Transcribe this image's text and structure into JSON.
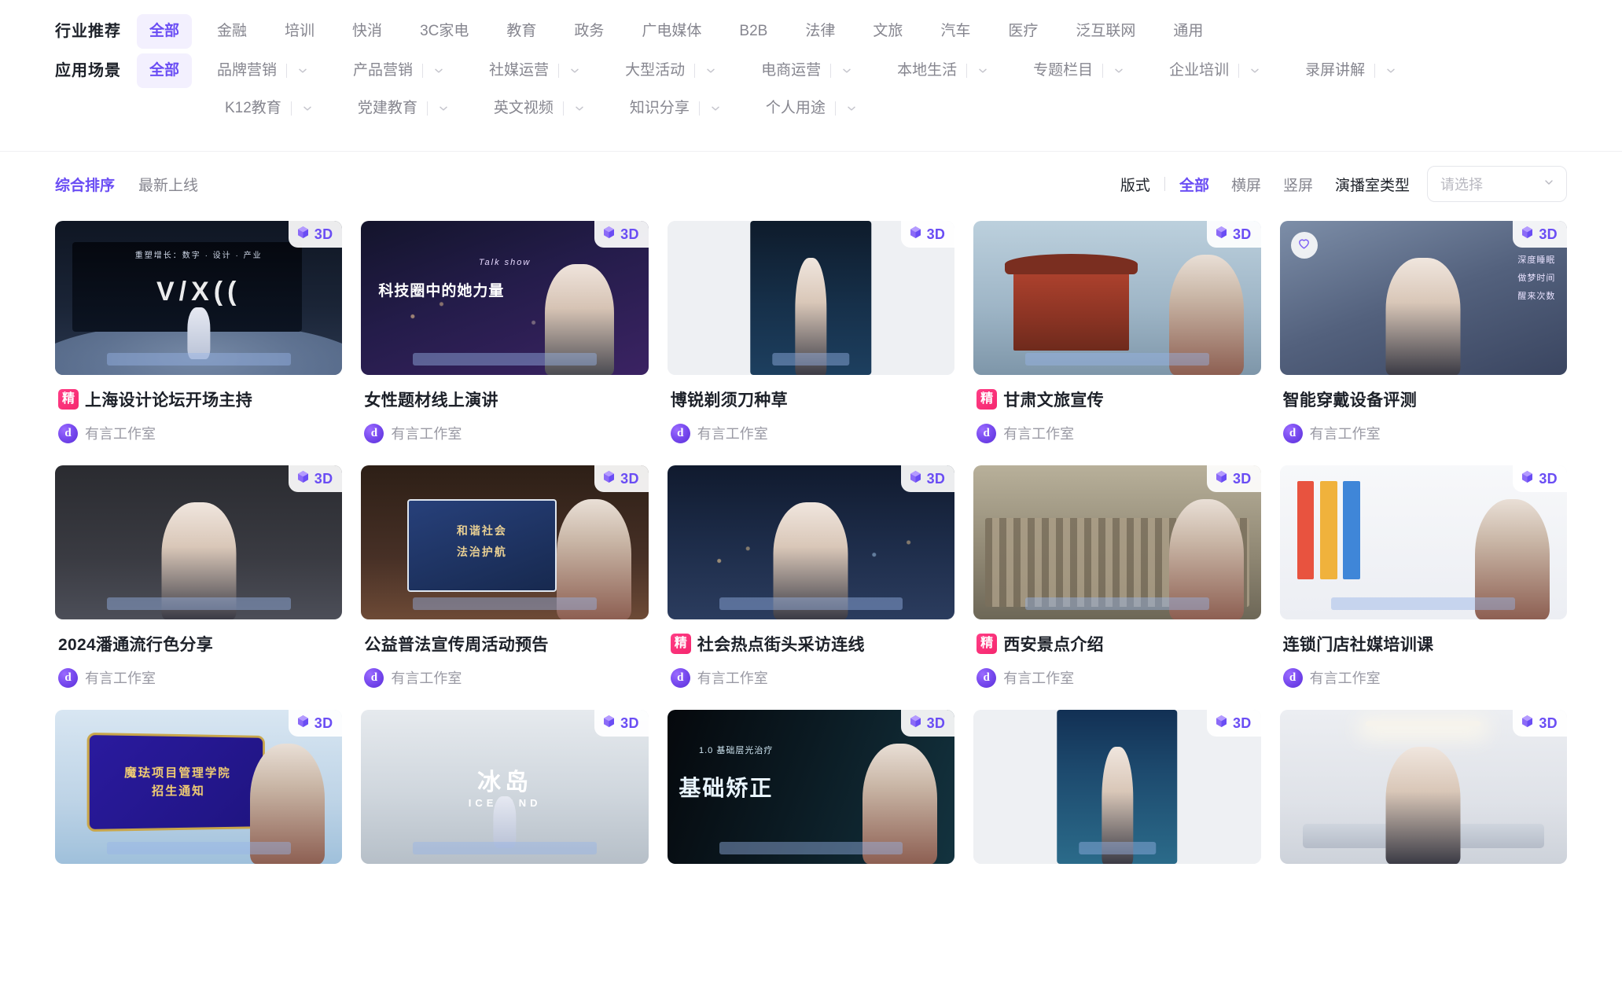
{
  "filters": {
    "industry": {
      "label": "行业推荐",
      "items": [
        {
          "label": "全部",
          "active": true
        },
        {
          "label": "金融",
          "active": false
        },
        {
          "label": "培训",
          "active": false
        },
        {
          "label": "快消",
          "active": false
        },
        {
          "label": "3C家电",
          "active": false
        },
        {
          "label": "教育",
          "active": false
        },
        {
          "label": "政务",
          "active": false
        },
        {
          "label": "广电媒体",
          "active": false
        },
        {
          "label": "B2B",
          "active": false
        },
        {
          "label": "法律",
          "active": false
        },
        {
          "label": "文旅",
          "active": false
        },
        {
          "label": "汽车",
          "active": false
        },
        {
          "label": "医疗",
          "active": false
        },
        {
          "label": "泛互联网",
          "active": false
        },
        {
          "label": "通用",
          "active": false
        }
      ]
    },
    "scene": {
      "label": "应用场景",
      "all": {
        "label": "全部",
        "active": true
      },
      "groups": [
        {
          "label": "品牌营销",
          "icon": "chevron-down-icon"
        },
        {
          "label": "产品营销",
          "icon": "chevron-down-icon"
        },
        {
          "label": "社媒运营",
          "icon": "chevron-down-icon"
        },
        {
          "label": "大型活动",
          "icon": "chevron-down-icon"
        },
        {
          "label": "电商运营",
          "icon": "chevron-down-icon"
        },
        {
          "label": "本地生活",
          "icon": "chevron-down-icon"
        },
        {
          "label": "专题栏目",
          "icon": "chevron-down-icon"
        },
        {
          "label": "企业培训",
          "icon": "chevron-down-icon"
        },
        {
          "label": "录屏讲解",
          "icon": "chevron-down-icon"
        },
        {
          "label": "K12教育",
          "icon": "chevron-down-icon"
        },
        {
          "label": "党建教育",
          "icon": "chevron-down-icon"
        },
        {
          "label": "英文视频",
          "icon": "chevron-down-icon"
        },
        {
          "label": "知识分享",
          "icon": "chevron-down-icon"
        },
        {
          "label": "个人用途",
          "icon": "chevron-down-icon"
        }
      ]
    }
  },
  "sortbar": {
    "options": [
      {
        "label": "综合排序",
        "active": true
      },
      {
        "label": "最新上线",
        "active": false
      }
    ],
    "layout_label": "版式",
    "layout_options": [
      {
        "label": "全部",
        "active": true
      },
      {
        "label": "横屏",
        "active": false
      },
      {
        "label": "竖屏",
        "active": false
      }
    ],
    "studio_label": "演播室类型",
    "studio_placeholder": "请选择",
    "studio_caret": "chevron-down-icon"
  },
  "badges": {
    "three_d": "3D",
    "featured": "精",
    "favorite_icon": "heart-icon",
    "cube_icon": "cube-3d-icon"
  },
  "cards": [
    {
      "title": "上海设计论坛开场主持",
      "author": "有言工作室",
      "featured": true,
      "three_d": true,
      "favorite": false,
      "art": "stage-forum"
    },
    {
      "title": "女性题材线上演讲",
      "author": "有言工作室",
      "featured": false,
      "three_d": true,
      "favorite": false,
      "art": "night-city"
    },
    {
      "title": "博锐剃须刀种草",
      "author": "有言工作室",
      "featured": false,
      "three_d": true,
      "favorite": false,
      "art": "vertical-product"
    },
    {
      "title": "甘肃文旅宣传",
      "author": "有言工作室",
      "featured": true,
      "three_d": true,
      "favorite": false,
      "art": "temple"
    },
    {
      "title": "智能穿戴设备评测",
      "author": "有言工作室",
      "featured": false,
      "three_d": true,
      "favorite": true,
      "art": "office-blue"
    },
    {
      "title": "2024潘通流行色分享",
      "author": "有言工作室",
      "featured": false,
      "three_d": true,
      "favorite": false,
      "art": "room-dark"
    },
    {
      "title": "公益普法宣传周活动预告",
      "author": "有言工作室",
      "featured": false,
      "three_d": true,
      "favorite": false,
      "art": "law"
    },
    {
      "title": "社会热点街头采访连线",
      "author": "有言工作室",
      "featured": true,
      "three_d": true,
      "favorite": false,
      "art": "news-night"
    },
    {
      "title": "西安景点介绍",
      "author": "有言工作室",
      "featured": true,
      "three_d": true,
      "favorite": false,
      "art": "terracotta"
    },
    {
      "title": "连锁门店社媒培训课",
      "author": "有言工作室",
      "featured": false,
      "three_d": true,
      "favorite": false,
      "art": "light-studio"
    },
    {
      "title": "",
      "author": "",
      "featured": false,
      "three_d": true,
      "favorite": false,
      "art": "purple-board"
    },
    {
      "title": "",
      "author": "",
      "featured": false,
      "three_d": true,
      "favorite": false,
      "art": "iceland"
    },
    {
      "title": "",
      "author": "",
      "featured": false,
      "three_d": true,
      "favorite": false,
      "art": "teal-dark"
    },
    {
      "title": "",
      "author": "",
      "featured": false,
      "three_d": true,
      "favorite": false,
      "art": "vertical-travel"
    },
    {
      "title": "",
      "author": "",
      "featured": false,
      "three_d": true,
      "favorite": false,
      "art": "lobby"
    }
  ],
  "thumb_text": {
    "forum_sub": "重塑增长：数字 · 设计 · 产业",
    "forum_logo": "V/X((",
    "keji": "科技圈中的她力量",
    "keji_sub": "Talk show",
    "wearable_lines": "深度睡眠\n做梦时间\n醒来次数",
    "harmony_l1": "和谐社会",
    "harmony_l2": "法治护航",
    "board_l1": "魔珐项目管理学院",
    "board_l2": "招生通知",
    "iceland_cn": "冰岛",
    "iceland_en": "ICELAND",
    "jiaozheng": "基础矫正",
    "jiaozheng_sub": "1.0 基础层光治疗"
  },
  "colors": {
    "accent": "#6a4df4",
    "accent_bg": "#f3f0fe",
    "featured_badge": "#f5276e",
    "text_primary": "#1d2129",
    "text_muted": "#86868f"
  }
}
